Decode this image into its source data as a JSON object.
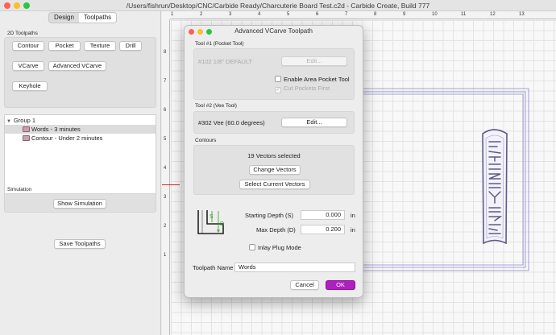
{
  "window": {
    "title": "/Users/fishrun/Desktop/CNC/Carbide Ready/Charcuterie Board Test.c2d - Carbide Create, Build 777"
  },
  "left_panel": {
    "tabs": [
      "Design",
      "Toolpaths"
    ],
    "active_tab": "Toolpaths",
    "toolpaths_section": {
      "label": "2D Toolpaths",
      "buttons": [
        "Contour",
        "Pocket",
        "Texture",
        "Drill",
        "VCarve",
        "Advanced VCarve",
        "Keyhole"
      ]
    },
    "tree": {
      "group": "Group 1",
      "items": [
        "Words - 3 minutes",
        "Contour - Under 2 minutes"
      ]
    },
    "simulation": {
      "label": "Simulation",
      "show_button": "Show Simulation",
      "save_button": "Save Toolpaths"
    }
  },
  "rulers": {
    "top": [
      "1",
      "2",
      "3",
      "4",
      "5",
      "6",
      "7",
      "8",
      "9",
      "10",
      "11",
      "12",
      "13"
    ],
    "left": [
      "8",
      "7",
      "6",
      "5",
      "4",
      "3",
      "2",
      "1"
    ]
  },
  "dialog": {
    "title": "Advanced VCarve Toolpath",
    "tool1": {
      "label": "Tool #1 (Pocket Tool)",
      "name": "#102 1/8\" DEFAULT",
      "edit_label": "Edit...",
      "enable_area_pocket": "Enable Area Pocket Tool",
      "cut_pockets_first": "Cut Pockets First",
      "cut_pockets_first_checked": true
    },
    "tool2": {
      "label": "Tool #2 (Vee Tool)",
      "name": "#302 Vee (60.0 degrees)",
      "edit_label": "Edit..."
    },
    "contours": {
      "label": "Contours",
      "selected_text": "19 Vectors selected",
      "change_button": "Change Vectors",
      "select_button": "Select Current Vectors"
    },
    "depth": {
      "diagram_s": "S",
      "diagram_d": "D",
      "start_label": "Starting Depth (S)",
      "start_value": "0.000",
      "max_label": "Max Depth (D)",
      "max_value": "0.200",
      "unit": "in",
      "inlay_label": "Inlay Plug Mode"
    },
    "toolpath_name_label": "Toolpath Name",
    "toolpath_name_value": "Words",
    "cancel_label": "Cancel",
    "ok_label": "OK"
  },
  "colors": {
    "accent": "#b01fbf",
    "vector_outline": "#5e5a8a",
    "toolpath_line": "#8a86c9"
  }
}
